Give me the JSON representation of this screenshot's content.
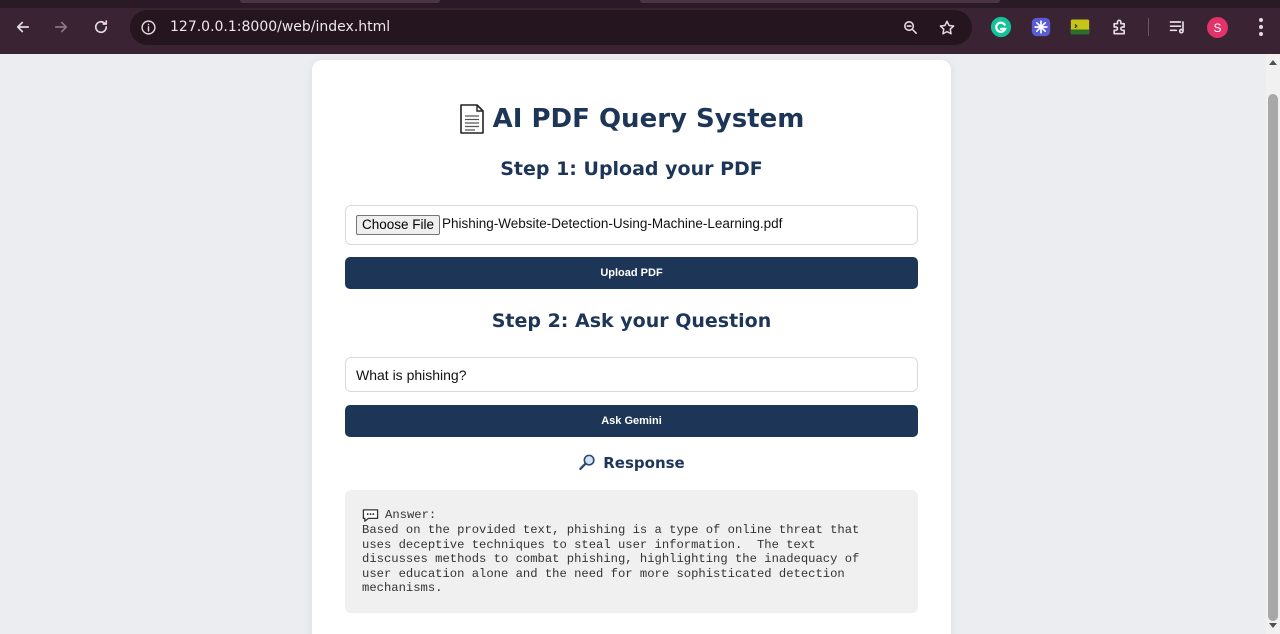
{
  "browser": {
    "url": "127.0.0.1:8000/web/index.html",
    "avatar_initial": "S"
  },
  "page": {
    "title": "AI PDF Query System",
    "step1_heading": "Step 1: Upload your PDF",
    "choose_file_label": "Choose File",
    "selected_file": "Phishing-Website-Detection-Using-Machine-Learning.pdf",
    "upload_button": "Upload PDF",
    "step2_heading": "Step 2: Ask your Question",
    "question_value": "What is phishing?",
    "ask_button": "Ask Gemini",
    "response_heading": "Response",
    "answer_label": "Answer:",
    "answer_text": "Based on the provided text, phishing is a type of online threat that\nuses deceptive techniques to steal user information.  The text\ndiscusses methods to combat phishing, highlighting the inadequacy of\nuser education alone and the need for more sophisticated detection\nmechanisms."
  },
  "colors": {
    "accent": "#1d3557",
    "page_bg": "#ebedf1",
    "chrome_bg": "#3a2434"
  },
  "icons": [
    "back-icon",
    "forward-icon",
    "reload-icon",
    "info-icon",
    "zoom-icon",
    "bookmark-star-icon",
    "grammarly-icon",
    "extension-icon",
    "extensions-puzzle-icon",
    "media-queue-icon",
    "menu-icon",
    "document-icon",
    "magnifier-icon",
    "speech-bubble-icon"
  ]
}
